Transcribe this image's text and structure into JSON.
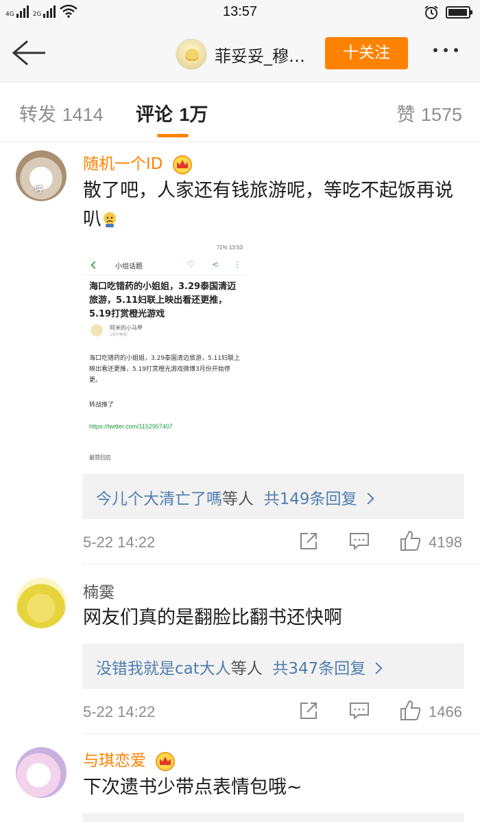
{
  "status_bar": {
    "net1": "4G",
    "net2": "2G",
    "time": "13:57"
  },
  "nav": {
    "title": "菲妥妥_穆…",
    "follow": "十关注"
  },
  "tabs": [
    {
      "label": "转发",
      "count": "1414"
    },
    {
      "label": "评论",
      "count": "1万"
    },
    {
      "label": "赞",
      "count": "1575"
    }
  ],
  "comments": [
    {
      "avatar_text": "哼",
      "username": "随机一个ID",
      "text": "散了吧，人家还有钱旅游呢，等吃不起饭再说叭",
      "reply_users": "今儿个大清亡了嗎",
      "reply_mid": "等人",
      "reply_count": "共149条回复",
      "time": "5-22 14:22",
      "likes": "4198"
    },
    {
      "username": "楠霙",
      "text": "网友们真的是翻脸比翻书还快啊",
      "reply_users": "没错我就是cat大人",
      "reply_mid": "等人",
      "reply_count": "共347条回复",
      "time": "5-22 14:22",
      "likes": "1466"
    },
    {
      "username": "与琪恋爱",
      "text": "下次遗书少带点表情包哦~"
    }
  ],
  "embedded_screenshot": {
    "status": "71%  13:53",
    "topic": "小组话题",
    "title": "海口吃错药的小姐姐，3.29泰国清迈旅游，5.11妇联上映出看还更推，5.19打赏橙光游戏",
    "author": "阿米的小马甲",
    "ago": "18分钟前",
    "body": "海口吃错药的小姐姐，3.29泰国清迈旅游，5.11妇联上映出看还更推，5.19打赏橙光游戏微博3月份开始停更。",
    "retweet": "转战推了",
    "link": "https://twitter.com/1152957407",
    "hot": "最赞回应"
  },
  "colors": {
    "accent": "#ff8200",
    "link_blue": "#507daf",
    "reply_bg": "#f2f2f2"
  },
  "icons": [
    "back-arrow-icon",
    "more-dots-icon",
    "crown-icon",
    "repost-icon",
    "comment-icon",
    "like-icon"
  ]
}
